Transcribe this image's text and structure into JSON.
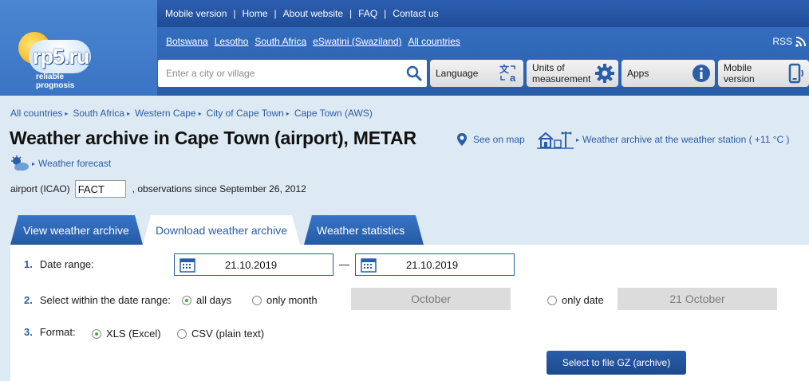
{
  "topnav": {
    "items": [
      "Mobile version",
      "Home",
      "About website",
      "FAQ",
      "Contact us"
    ]
  },
  "countries": [
    "Botswana",
    "Lesotho",
    "South Africa",
    "eSwatini (Swaziland)",
    "All countries"
  ],
  "rss": "RSS",
  "logo": {
    "name": "rp5.ru",
    "tagline_1": "reliable",
    "tagline_2": "prognosis"
  },
  "search": {
    "placeholder": "Enter a city or village"
  },
  "header_buttons": {
    "language": "Language",
    "units_1": "Units of",
    "units_2": "measurement",
    "apps": "Apps",
    "mobile_1": "Mobile",
    "mobile_2": "version"
  },
  "breadcrumb": [
    "All countries",
    "South Africa",
    "Western Cape",
    "City of Cape Town",
    "Cape Town (AWS)"
  ],
  "title": "Weather archive in Cape Town (airport), METAR",
  "see_on_map": "See on map",
  "station_link": "Weather archive at the weather station ( +11 °C )",
  "forecast_link": "Weather forecast",
  "icao": {
    "label": "airport (ICAO)",
    "value": "FACT",
    "since": ", observations since September 26, 2012"
  },
  "tabs": [
    "View weather archive",
    "Download weather archive",
    "Weather statistics"
  ],
  "form": {
    "row1": {
      "num": "1.",
      "label": "Date range:",
      "from": "21.10.2019",
      "dash": "—",
      "to": "21.10.2019"
    },
    "row2": {
      "num": "2.",
      "label": "Select within the date range:",
      "all_days": "all days",
      "only_month": "only month",
      "month_value": "October",
      "only_date": "only date",
      "date_value": "21 October"
    },
    "row3": {
      "num": "3.",
      "label": "Format:",
      "xls": "XLS (Excel)",
      "csv": "CSV (plain text)"
    },
    "gz_button": "Select to file GZ (archive)"
  },
  "colors": {
    "brand_blue": "#2a5ea9",
    "radio_on": "#3bb034"
  }
}
